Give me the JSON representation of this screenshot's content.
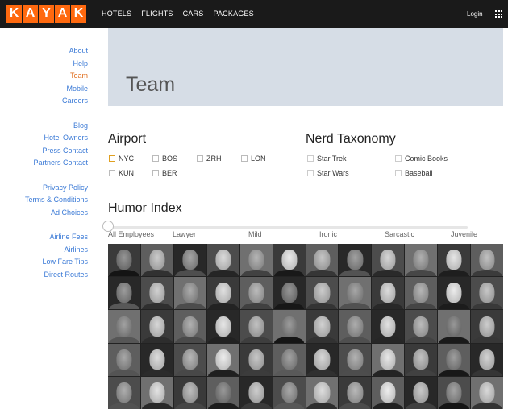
{
  "header": {
    "logo_letters": [
      "K",
      "A",
      "Y",
      "A",
      "K"
    ],
    "nav": [
      "HOTELS",
      "FLIGHTS",
      "CARS",
      "PACKAGES"
    ],
    "login": "Login"
  },
  "sidebar": {
    "groups": [
      [
        {
          "label": "About"
        },
        {
          "label": "Help"
        },
        {
          "label": "Team",
          "active": true
        },
        {
          "label": "Mobile"
        },
        {
          "label": "Careers"
        }
      ],
      [
        {
          "label": "Blog"
        },
        {
          "label": "Hotel Owners"
        },
        {
          "label": "Press Contact"
        },
        {
          "label": "Partners Contact"
        }
      ],
      [
        {
          "label": "Privacy Policy"
        },
        {
          "label": "Terms & Conditions"
        },
        {
          "label": "Ad Choices"
        }
      ],
      [
        {
          "label": "Airline Fees"
        },
        {
          "label": "Airlines"
        },
        {
          "label": "Low Fare Tips"
        },
        {
          "label": "Direct Routes"
        }
      ]
    ]
  },
  "hero": {
    "title": "Team"
  },
  "airport": {
    "title": "Airport",
    "options": [
      {
        "label": "NYC",
        "checked": true
      },
      {
        "label": "BOS"
      },
      {
        "label": "ZRH"
      },
      {
        "label": "LON"
      },
      {
        "label": "KUN"
      },
      {
        "label": "BER"
      }
    ]
  },
  "taxonomy": {
    "title": "Nerd Taxonomy",
    "options": [
      {
        "label": "Star Trek"
      },
      {
        "label": "Comic Books"
      },
      {
        "label": "Star Wars"
      },
      {
        "label": "Baseball"
      }
    ]
  },
  "humor": {
    "title": "Humor Index",
    "ticks": [
      "All Employees",
      "Lawyer",
      "Mild",
      "Ironic",
      "Sarcastic",
      "Juvenile"
    ],
    "selected_index": 0
  },
  "photos": {
    "rows": 5,
    "cols": 12
  }
}
